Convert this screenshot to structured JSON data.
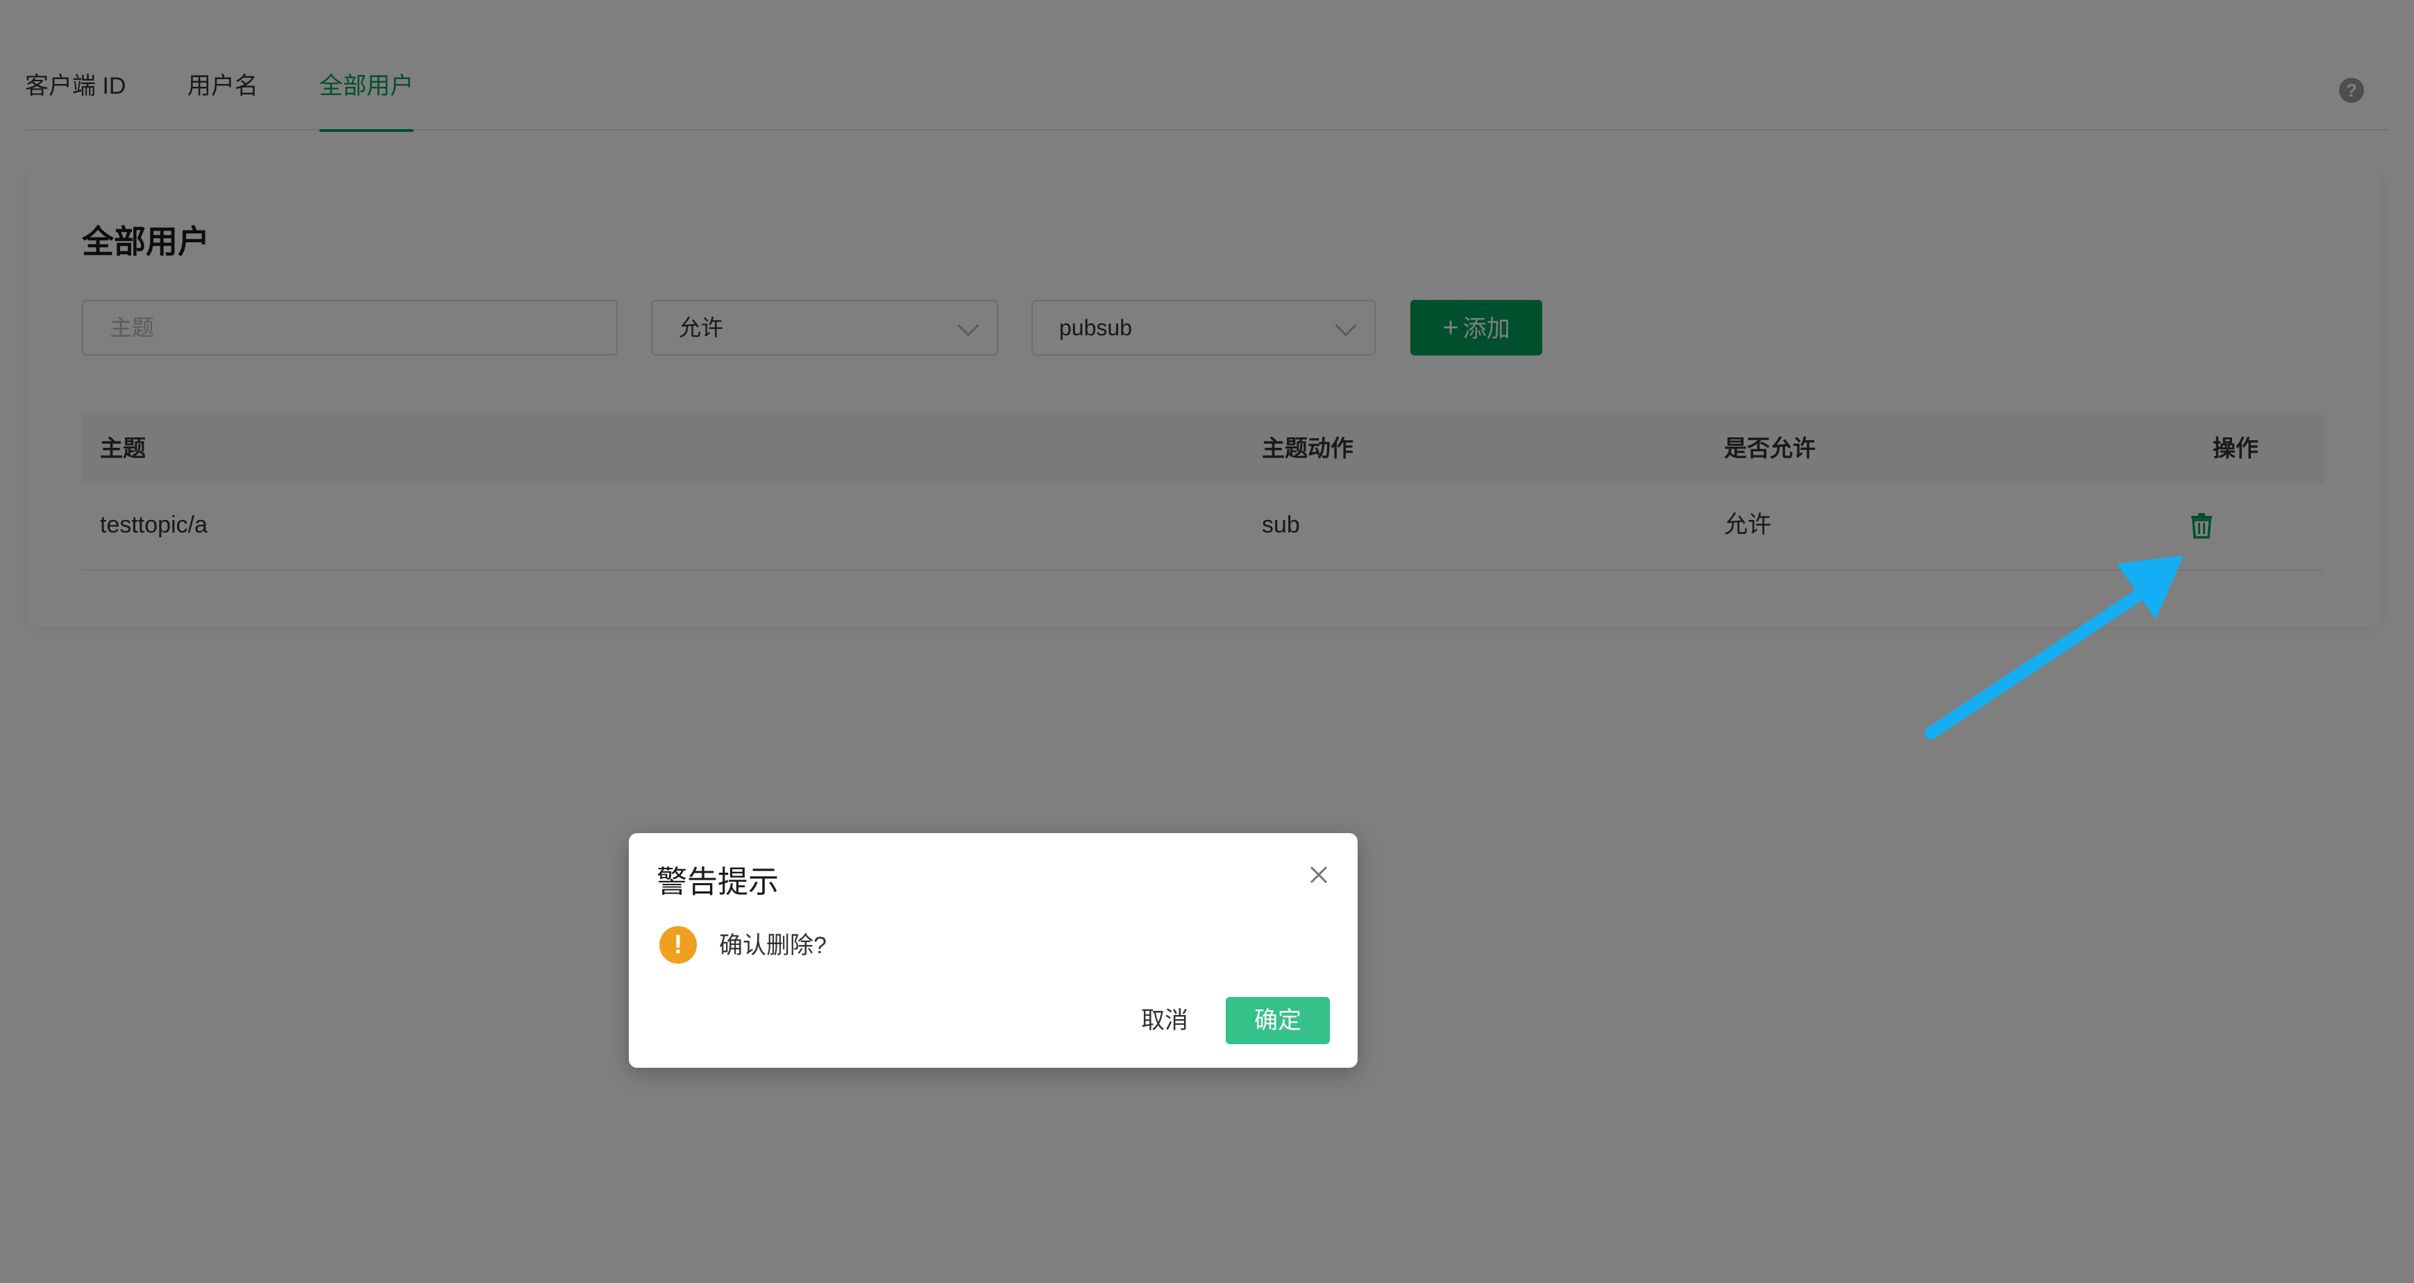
{
  "tabs": [
    {
      "label": "客户端 ID",
      "active": false
    },
    {
      "label": "用户名",
      "active": false
    },
    {
      "label": "全部用户",
      "active": true
    }
  ],
  "help_icon": "question-circle-icon",
  "card": {
    "title": "全部用户",
    "topic_input": {
      "placeholder": "主题",
      "value": ""
    },
    "permission_select": {
      "value": "允许"
    },
    "action_select": {
      "value": "pubsub"
    },
    "add_button": {
      "label": "添加",
      "icon": "plus-icon"
    }
  },
  "table": {
    "columns": [
      "主题",
      "主题动作",
      "是否允许",
      "操作"
    ],
    "rows": [
      {
        "topic": "testtopic/a",
        "action": "sub",
        "allow": "允许",
        "op_icon": "trash-icon"
      }
    ]
  },
  "dialog": {
    "title": "警告提示",
    "message": "确认删除?",
    "cancel_label": "取消",
    "ok_label": "确定",
    "icon": "warning-icon"
  },
  "colors": {
    "accent": "#00a15a",
    "confirm": "#34c18a",
    "warning": "#f0a020",
    "annotation_arrow": "#14aef5"
  }
}
